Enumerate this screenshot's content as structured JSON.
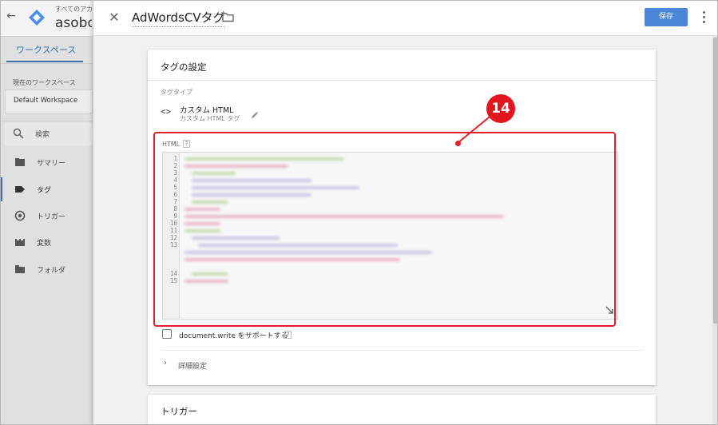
{
  "background_app": {
    "back_icon": "arrow-left-icon",
    "logo_icon": "gtm-logo-icon",
    "account_label": "すべてのアカウント",
    "container_name": "asobouweb",
    "workspace_tab": "ワークスペース",
    "current_workspace_caption": "現在のワークスペース",
    "workspace_name": "Default Workspace",
    "search_label": "検索",
    "nav": [
      {
        "label": "サマリー",
        "icon": "folder-icon"
      },
      {
        "label": "タグ",
        "icon": "tag-icon",
        "active": true
      },
      {
        "label": "トリガー",
        "icon": "trigger-icon"
      },
      {
        "label": "変数",
        "icon": "variables-icon"
      },
      {
        "label": "フォルダ",
        "icon": "folder-icon"
      }
    ],
    "accent_color": "#3b6fa8"
  },
  "tag_editor": {
    "close_icon": "close-icon",
    "tag_name": "AdWordsCVタグ",
    "folder_icon": "folder-outline-icon",
    "save_label": "保存",
    "more_icon": "more-vert-icon",
    "save_color": "#4a87d9"
  },
  "config_card": {
    "title": "タグの設定",
    "tag_type_caption": "タグタイプ",
    "tag_type_icon": "code-icon",
    "tag_type_name": "カスタム HTML",
    "tag_type_sub": "カスタム HTML タグ",
    "edit_icon": "pencil-icon",
    "html_label": "HTML",
    "help_glyph": "?",
    "line_numbers": [
      "1",
      "2",
      "3",
      "4",
      "5",
      "6",
      "7",
      "8",
      "9",
      "10",
      "11",
      "12",
      "13",
      "",
      "",
      "14",
      "15"
    ],
    "document_write_label": "document.write をサポートする",
    "advanced_label": "詳細設定",
    "advanced_chevron": "›"
  },
  "trigger_card": {
    "title": "トリガー"
  },
  "annotation": {
    "number": "14",
    "color": "#e0202a"
  }
}
